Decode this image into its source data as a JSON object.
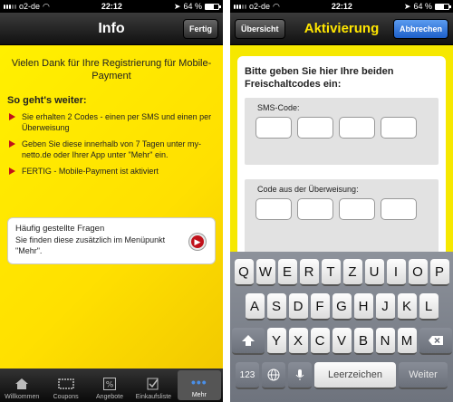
{
  "status_left": {
    "carrier": "o2-de",
    "time": "22:12",
    "battery_pct": "64 %"
  },
  "status_right": {
    "carrier": "o2-de",
    "time": "22:12",
    "battery_pct": "64 %"
  },
  "info": {
    "title": "Info",
    "done_button": "Fertig",
    "thanks": "Vielen Dank für Ihre Registrierung für Mobile-Payment",
    "howto_title": "So geht's weiter:",
    "steps": [
      "Sie erhalten 2 Codes - einen per SMS und einen per Überweisung",
      "Geben Sie diese innerhalb von 7 Tagen unter my-netto.de oder Ihrer App unter \"Mehr\" ein.",
      "FERTIG - Mobile-Payment ist aktiviert"
    ],
    "faq_title": "Häufig gestellte Fragen",
    "faq_sub": "Sie finden diese zusätzlich im Menüpunkt \"Mehr\"."
  },
  "tabs": [
    "Willkommen",
    "Coupons",
    "Angebote",
    "Einkaufsliste",
    "Mehr"
  ],
  "activation": {
    "title": "Aktivierung",
    "overview_button": "Übersicht",
    "cancel_button": "Abbrechen",
    "instruction": "Bitte geben Sie hier Ihre beiden Freischaltcodes ein:",
    "sms_label": "SMS-Code:",
    "transfer_label": "Code aus der Überweisung:"
  },
  "keyboard": {
    "row1": [
      "Q",
      "W",
      "E",
      "R",
      "T",
      "Z",
      "U",
      "I",
      "O",
      "P"
    ],
    "row2": [
      "A",
      "S",
      "D",
      "F",
      "G",
      "H",
      "J",
      "K",
      "L"
    ],
    "row3": [
      "Y",
      "X",
      "C",
      "V",
      "B",
      "N",
      "M"
    ],
    "num_key": "123",
    "space_key": "Leerzeichen",
    "return_key": "Weiter"
  },
  "icons": {
    "shift": "shift-icon",
    "backspace": "backspace-icon",
    "globe": "globe-icon",
    "mic": "microphone-icon",
    "arrow": "arrow-right-icon"
  },
  "colors": {
    "brand_yellow": "#ffe600",
    "accent_red": "#c0111b",
    "accent_blue": "#1d5fc9"
  }
}
